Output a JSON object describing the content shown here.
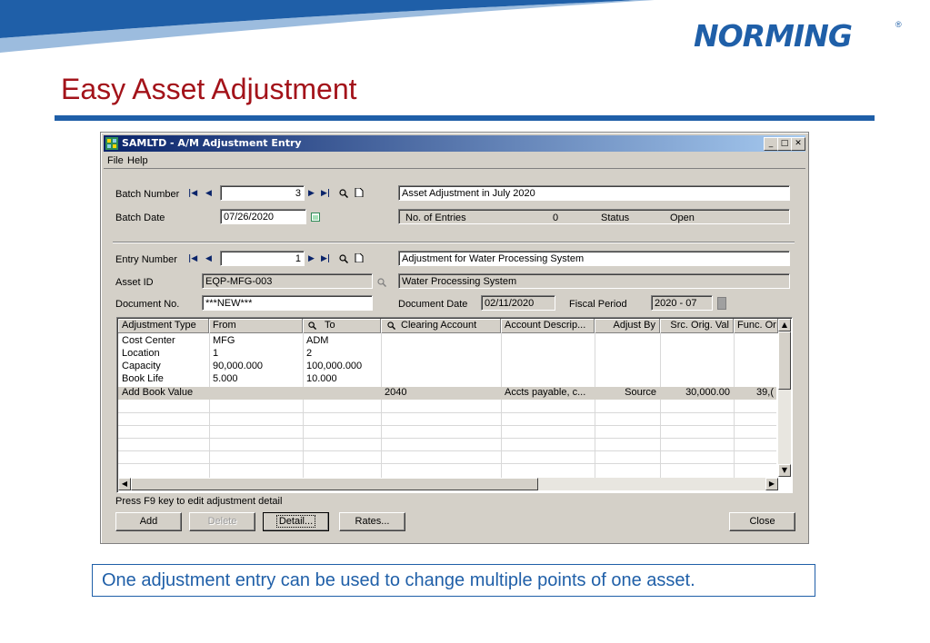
{
  "slide": {
    "logo": "NORMING",
    "logo_reg": "®",
    "title": "Easy Asset Adjustment",
    "caption": "One adjustment entry can be used to change multiple points of one asset.",
    "colors": {
      "title": "#a3131a",
      "brand_blue": "#1f5fa8"
    }
  },
  "window": {
    "title": "SAMLTD - A/M Adjustment Entry",
    "menu": {
      "file": "File",
      "help": "Help"
    },
    "batch": {
      "number_label": "Batch Number",
      "number_value": "3",
      "description": "Asset Adjustment in July 2020",
      "date_label": "Batch Date",
      "date_value": "07/26/2020",
      "entries_label": "No. of Entries",
      "entries_value": "0",
      "status_label": "Status",
      "status_value": "Open"
    },
    "entry": {
      "number_label": "Entry Number",
      "number_value": "1",
      "description": "Adjustment for Water Processing System",
      "asset_label": "Asset ID",
      "asset_value": "EQP-MFG-003",
      "asset_desc": "Water Processing System",
      "doc_label": "Document No.",
      "doc_value": "***NEW***",
      "doc_date_label": "Document Date",
      "doc_date_value": "02/11/2020",
      "period_label": "Fiscal Period",
      "period_value": "2020 - 07"
    },
    "grid": {
      "headers": [
        "Adjustment Type",
        "From",
        "To",
        "Clearing Account",
        "Account Descrip...",
        "Adjust By",
        "Src. Orig. Val",
        "Func. Or"
      ],
      "rows": [
        [
          "Cost Center",
          "MFG",
          "ADM",
          "",
          "",
          "",
          "",
          ""
        ],
        [
          "Location",
          "1",
          "2",
          "",
          "",
          "",
          "",
          ""
        ],
        [
          "Capacity",
          "90,000.000",
          "100,000.000",
          "",
          "",
          "",
          "",
          ""
        ],
        [
          "Book Life",
          "5.000",
          "10.000",
          "",
          "",
          "",
          "",
          ""
        ],
        [
          "Add Book Value",
          "",
          "",
          "2040",
          "Accts payable, c...",
          "Source",
          "30,000.00",
          "39,("
        ]
      ]
    },
    "hint": "Press F9 key to edit adjustment detail",
    "buttons": {
      "add": "Add",
      "delete": "Delete",
      "detail": "Detail...",
      "rates": "Rates...",
      "close": "Close"
    }
  }
}
